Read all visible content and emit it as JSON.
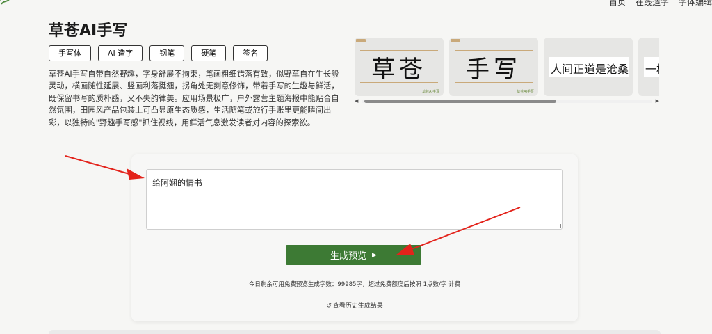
{
  "nav": {
    "items": [
      "首页",
      "在线造字",
      "字体编辑"
    ]
  },
  "page": {
    "title": "草苍AI手写"
  },
  "tags": [
    "手写体",
    "AI 造字",
    "钢笔",
    "硬笔",
    "签名"
  ],
  "description": "草苍AI手写自带自然野趣，字身舒展不拘束，笔画粗细错落有致，似野草自在生长般灵动，横画随性延展、竖画利落挺翘，拐角处无刻意修饰，带着手写的生趣与鲜活，既保留书写的质朴感，又不失韵律美。应用场景极广，户外露营主题海报中能贴合自然氛围，田园风产品包装上可凸显原生态质感，生活随笔或旅行手账里更能瞬间出彩，以独特的\"野趣手写感\"抓住视线，用鲜活气息激发读者对内容的探索欲。",
  "gallery": {
    "cards": [
      {
        "text": "草苍",
        "style": "beige"
      },
      {
        "text": "手写",
        "style": "beige"
      },
      {
        "text": "人间正道是沧桑",
        "style": "white"
      },
      {
        "text": "一杯",
        "style": "white"
      }
    ],
    "badge": "草苍AI手写"
  },
  "editor": {
    "value": "给阿娴的情书",
    "generate_label": "生成预览",
    "quota_text": "今日剩余可用免费预览生成字数：99985字，超过免费额度后按照 1点数/字 计费",
    "history_label": "查看历史生成结果"
  },
  "colors": {
    "primary_button": "#3d7a34",
    "annotation_arrow": "#e3231b"
  }
}
